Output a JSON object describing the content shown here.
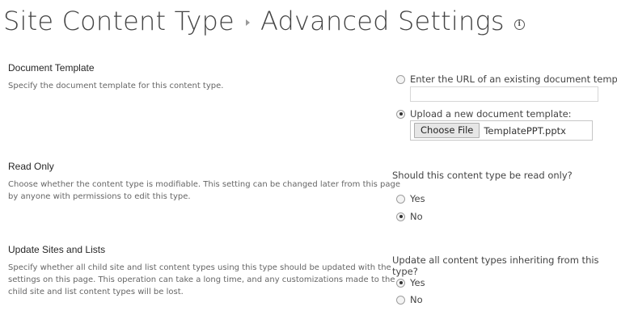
{
  "header": {
    "breadcrumb_parent": "Site Content Type",
    "page_title": "Advanced Settings"
  },
  "document_template": {
    "title": "Document Template",
    "description": "Specify the document template for this content type.",
    "option_url_label": "Enter the URL of an existing document template:",
    "url_value": "",
    "option_upload_label": "Upload a new document template:",
    "choose_file_label": "Choose File",
    "file_name": "TemplatePPT.pptx",
    "selected": "upload"
  },
  "read_only": {
    "title": "Read Only",
    "description_line1": "Choose whether the content type is modifiable. This setting can be changed later from this page",
    "description_line2": "by anyone with permissions to edit this type.",
    "question": "Should this content type be read only?",
    "option_yes": "Yes",
    "option_no": "No",
    "selected": "No"
  },
  "update_sites": {
    "title": "Update Sites and Lists",
    "description_line1": "Specify whether all child site and list content types using this type should be updated with the",
    "description_line2": "settings on this page. This operation can take a long time, and any customizations made to the",
    "description_line3": "child site and list content types will be lost.",
    "question": "Update all content types inheriting from this type?",
    "option_yes": "Yes",
    "option_no": "No",
    "selected": "Yes"
  }
}
